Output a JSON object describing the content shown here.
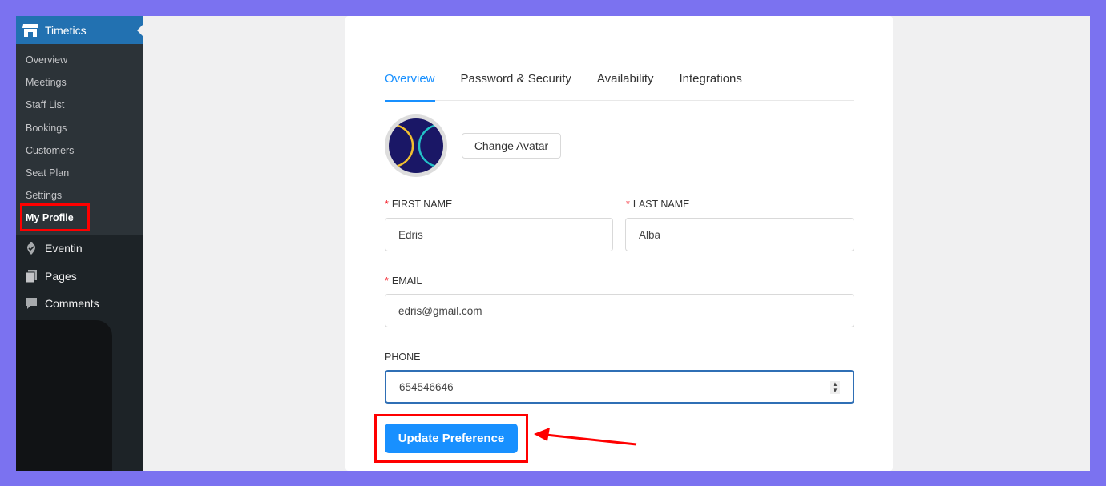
{
  "sidebar": {
    "title": "Timetics",
    "items": [
      "Overview",
      "Meetings",
      "Staff List",
      "Bookings",
      "Customers",
      "Seat Plan",
      "Settings",
      "My Profile"
    ],
    "menu": [
      {
        "label": "Eventin",
        "icon": "eventin-icon"
      },
      {
        "label": "Pages",
        "icon": "pages-icon"
      },
      {
        "label": "Comments",
        "icon": "comments-icon"
      }
    ]
  },
  "tabs": [
    "Overview",
    "Password & Security",
    "Availability",
    "Integrations"
  ],
  "active_tab": "Overview",
  "avatar": {
    "change_label": "Change Avatar"
  },
  "form": {
    "first_name": {
      "label": "FIRST NAME",
      "value": "Edris",
      "required": "*"
    },
    "last_name": {
      "label": "LAST NAME",
      "value": "Alba",
      "required": "*"
    },
    "email": {
      "label": "EMAIL",
      "value": "edris@gmail.com",
      "required": "*"
    },
    "phone": {
      "label": "PHONE",
      "value": "654546646"
    }
  },
  "update_label": "Update Preference",
  "colors": {
    "accent": "#1890ff",
    "wp_blue": "#2271b1",
    "annotation": "#ff0000",
    "frame": "#7b72f0"
  }
}
